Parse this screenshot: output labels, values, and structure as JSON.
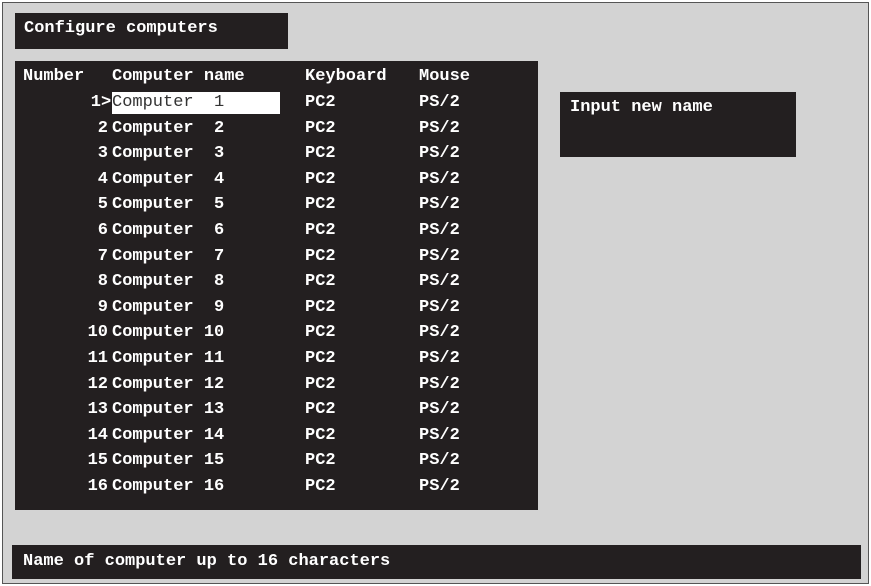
{
  "title": "Configure computers",
  "columns": {
    "number": "Number",
    "name": "Computer name",
    "keyboard": "Keyboard",
    "mouse": "Mouse"
  },
  "rows": [
    {
      "num": "1",
      "name": "Computer  1",
      "keyboard": "PC2",
      "mouse": "PS/2",
      "selected": true
    },
    {
      "num": "2",
      "name": "Computer  2",
      "keyboard": "PC2",
      "mouse": "PS/2"
    },
    {
      "num": "3",
      "name": "Computer  3",
      "keyboard": "PC2",
      "mouse": "PS/2"
    },
    {
      "num": "4",
      "name": "Computer  4",
      "keyboard": "PC2",
      "mouse": "PS/2"
    },
    {
      "num": "5",
      "name": "Computer  5",
      "keyboard": "PC2",
      "mouse": "PS/2"
    },
    {
      "num": "6",
      "name": "Computer  6",
      "keyboard": "PC2",
      "mouse": "PS/2"
    },
    {
      "num": "7",
      "name": "Computer  7",
      "keyboard": "PC2",
      "mouse": "PS/2"
    },
    {
      "num": "8",
      "name": "Computer  8",
      "keyboard": "PC2",
      "mouse": "PS/2"
    },
    {
      "num": "9",
      "name": "Computer  9",
      "keyboard": "PC2",
      "mouse": "PS/2"
    },
    {
      "num": "10",
      "name": "Computer 10",
      "keyboard": "PC2",
      "mouse": "PS/2"
    },
    {
      "num": "11",
      "name": "Computer 11",
      "keyboard": "PC2",
      "mouse": "PS/2"
    },
    {
      "num": "12",
      "name": "Computer 12",
      "keyboard": "PC2",
      "mouse": "PS/2"
    },
    {
      "num": "13",
      "name": "Computer 13",
      "keyboard": "PC2",
      "mouse": "PS/2"
    },
    {
      "num": "14",
      "name": "Computer 14",
      "keyboard": "PC2",
      "mouse": "PS/2"
    },
    {
      "num": "15",
      "name": "Computer 15",
      "keyboard": "PC2",
      "mouse": "PS/2"
    },
    {
      "num": "16",
      "name": "Computer 16",
      "keyboard": "PC2",
      "mouse": "PS/2"
    }
  ],
  "cursor": ">",
  "prompt": "Input new name",
  "status": "Name of computer up to 16 characters",
  "colors": {
    "panel": "#231f20",
    "screen": "#d3d3d3",
    "text": "#ffffff"
  }
}
